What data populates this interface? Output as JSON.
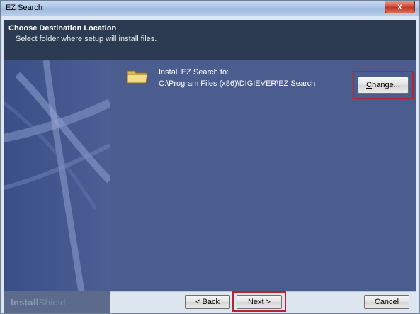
{
  "window": {
    "title": "EZ Search",
    "close_glyph": "x"
  },
  "header": {
    "title": "Choose Destination Location",
    "subtitle": "Select folder where setup will install files."
  },
  "main": {
    "install_label": "Install EZ Search to:",
    "install_path": "C:\\Program Files (x86)\\DIGIEVER\\EZ Search",
    "folder_icon": "folder-icon",
    "highlight_color": "#b3262e"
  },
  "buttons": {
    "change": {
      "mnemonic": "C",
      "rest": "hange..."
    },
    "back": {
      "prefix": "< ",
      "mnemonic": "B",
      "rest": "ack"
    },
    "next": {
      "mnemonic": "N",
      "rest": "ext >"
    },
    "cancel": "Cancel"
  },
  "footer": {
    "logo_bold": "Install",
    "logo_light": "Shield"
  }
}
